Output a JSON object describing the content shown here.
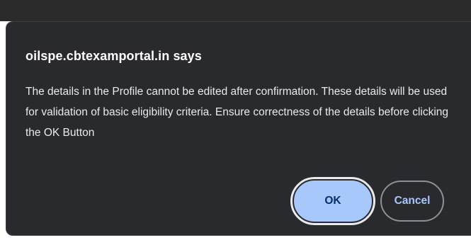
{
  "dialog": {
    "title": "oilspe.cbtexamportal.in says",
    "message": "The details in the Profile cannot be edited after confirmation. These details will be used for validation of basic eligibility criteria. Ensure correctness of the details before clicking the OK Button",
    "ok_label": "OK",
    "cancel_label": "Cancel"
  },
  "colors": {
    "dialog_background": "#292a2d",
    "primary_button": "#a8c7fa",
    "primary_button_text": "#062e6f",
    "secondary_button_text": "#a8c7fa"
  }
}
